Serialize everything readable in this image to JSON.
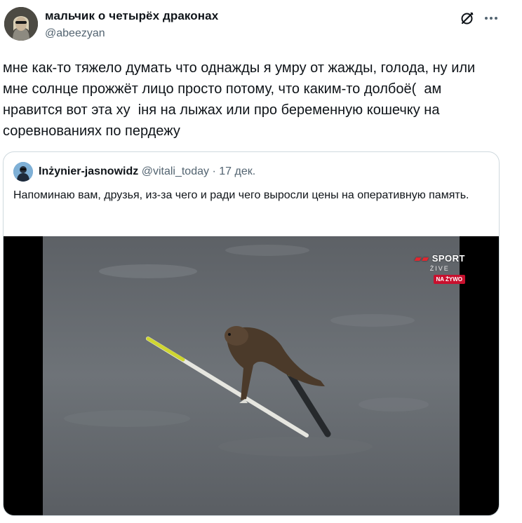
{
  "author": {
    "display_name": "мальчик о четырёх драконах",
    "handle": "@abeezyan"
  },
  "tweet": {
    "text": "мне как-то тяжело думать что однажды я умру от жажды, голода, ну или\nмне солнце прожжёт лицо просто потому, что каким-то долбоё(  ам\nнравится вот эта ху  іня на лыжах или про беременную кошечку на\nсоревнованиях по пердежу"
  },
  "quoted": {
    "display_name": "Inżynier-jasnowidz",
    "handle": "@vitali_today",
    "separator": "·",
    "date": "17 дек.",
    "text": "Напоминаю вам, друзья, из-за чего и ради чего выросли цены на оперативную память.",
    "media": {
      "watermark_sport": "SPORT",
      "watermark_live": "ŻIVE",
      "watermark_badge": "NA ŻYWO"
    }
  },
  "icons": [
    "grok-icon",
    "more-icon"
  ],
  "colors": {
    "text_primary": "#0f1419",
    "text_secondary": "#536471",
    "border": "#cfd9de",
    "badge_red": "#c8102e"
  }
}
